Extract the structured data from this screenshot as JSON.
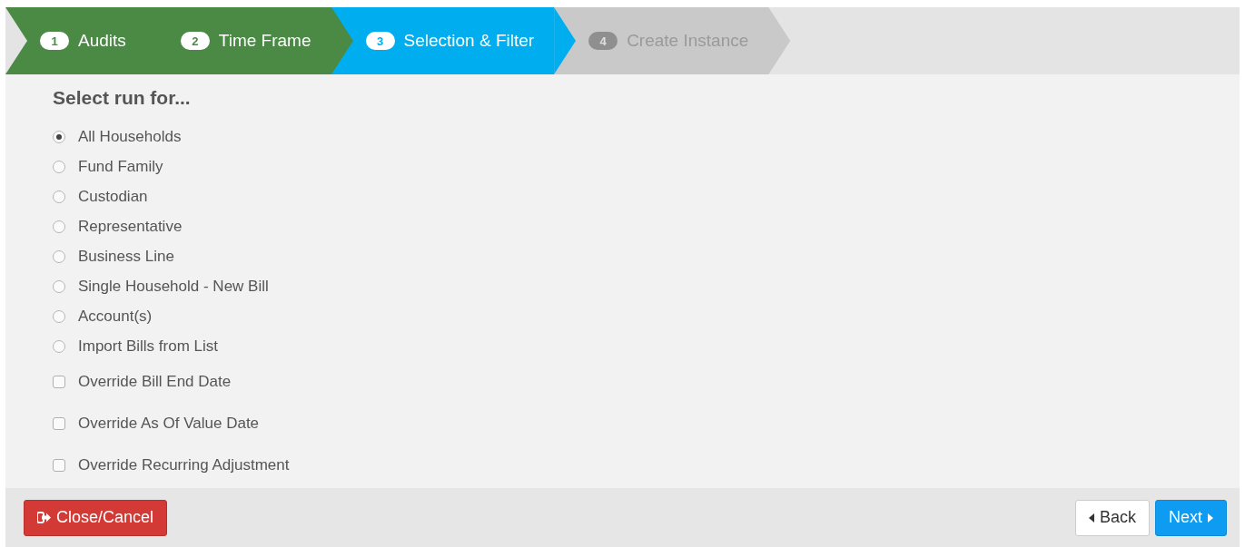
{
  "steps": [
    {
      "number": "1",
      "label": "Audits",
      "completed": true,
      "selected": false
    },
    {
      "number": "2",
      "label": "Time Frame",
      "completed": true,
      "selected": false
    },
    {
      "number": "3",
      "label": "Selection & Filter",
      "completed": false,
      "selected": true
    },
    {
      "number": "4",
      "label": "Create Instance",
      "completed": false,
      "selected": false
    }
  ],
  "heading": "Select run for...",
  "options": [
    {
      "kind": "radio",
      "label": "All Households",
      "selected": true
    },
    {
      "kind": "radio",
      "label": "Fund Family",
      "selected": false
    },
    {
      "kind": "radio",
      "label": "Custodian",
      "selected": false
    },
    {
      "kind": "radio",
      "label": "Representative",
      "selected": false
    },
    {
      "kind": "radio",
      "label": "Business Line",
      "selected": false
    },
    {
      "kind": "radio",
      "label": "Single Household - New Bill",
      "selected": false
    },
    {
      "kind": "radio",
      "label": "Account(s)",
      "selected": false
    },
    {
      "kind": "radio",
      "label": "Import Bills from List",
      "selected": false
    },
    {
      "kind": "checkbox",
      "label": "Override Bill End Date",
      "checked": false
    },
    {
      "kind": "checkbox",
      "label": "Override As Of Value Date",
      "checked": false
    },
    {
      "kind": "checkbox",
      "label": "Override Recurring Adjustment",
      "checked": false
    }
  ],
  "footer": {
    "cancel": "Close/Cancel",
    "back": "Back",
    "next": "Next"
  }
}
